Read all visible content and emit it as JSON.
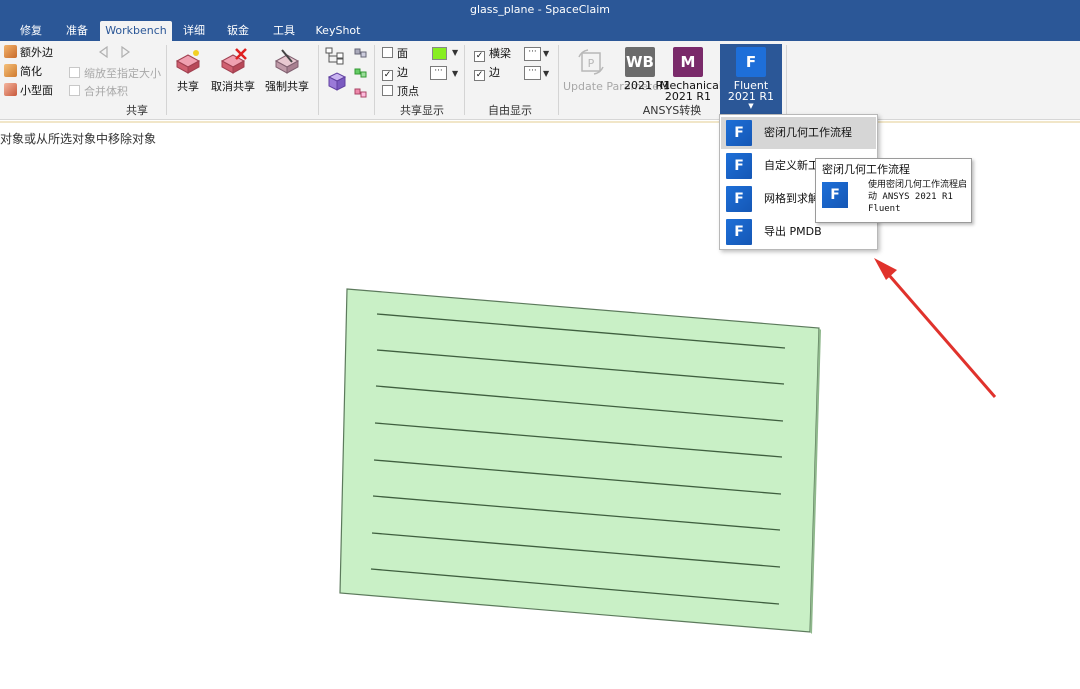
{
  "window": {
    "title": "glass_plane - SpaceClaim"
  },
  "tabs": [
    {
      "label": "修复"
    },
    {
      "label": "准备"
    },
    {
      "label": "Workbench",
      "active": true
    },
    {
      "label": "详细"
    },
    {
      "label": "钣金"
    },
    {
      "label": "工具"
    },
    {
      "label": "KeyShot"
    }
  ],
  "ribbon": {
    "group_share": {
      "label": "共享",
      "small_buttons": [
        "额外边",
        "简化",
        "小型面"
      ],
      "disabled_checks": [
        "缩放至指定大小",
        "合并体积"
      ],
      "big_buttons": [
        "共享",
        "取消共享",
        "强制共享"
      ]
    },
    "group_shared_display": {
      "label": "共享显示",
      "checks": [
        {
          "label": "面",
          "checked": false
        },
        {
          "label": "边",
          "checked": true
        },
        {
          "label": "顶点",
          "checked": false
        }
      ],
      "face_color": "#88ee22"
    },
    "group_free_display": {
      "label": "自由显示",
      "checks": [
        {
          "label": "横梁",
          "checked": true
        },
        {
          "label": "边",
          "checked": true
        }
      ]
    },
    "group_ansys": {
      "label": "ANSYS转换",
      "buttons": [
        {
          "label": "Update Parameters",
          "disabled": true,
          "icon": "update-parameters-icon"
        },
        {
          "label": "2021 R1",
          "tile": "WB",
          "tile_color": "#6b6b6b"
        },
        {
          "label": "Mechanical 2021 R1",
          "tile": "M",
          "tile_color": "#7a2a6a"
        },
        {
          "label": "Fluent 2021 R1",
          "tile": "F",
          "tile_color": "#1e6fd9",
          "active": true
        }
      ]
    }
  },
  "hint_text": "对象或从所选对象中移除对象",
  "fluent_menu": {
    "items": [
      {
        "label": "密闭几何工作流程",
        "highlighted": true
      },
      {
        "label": "自定义新工"
      },
      {
        "label": "网格到求解"
      },
      {
        "label": "导出 PMDB"
      }
    ]
  },
  "tooltip": {
    "title": "密闭几何工作流程",
    "description": "使用密闭几何工作流程启动 ANSYS 2021 R1 Fluent"
  },
  "colors": {
    "titlebar": "#2b5797",
    "plate_fill": "#c9f0c6",
    "plate_stroke": "#5c7a5c",
    "arrow": "#e0322c"
  },
  "icons": {
    "fluent": "F",
    "workbench": "WB",
    "mechanical": "M"
  }
}
